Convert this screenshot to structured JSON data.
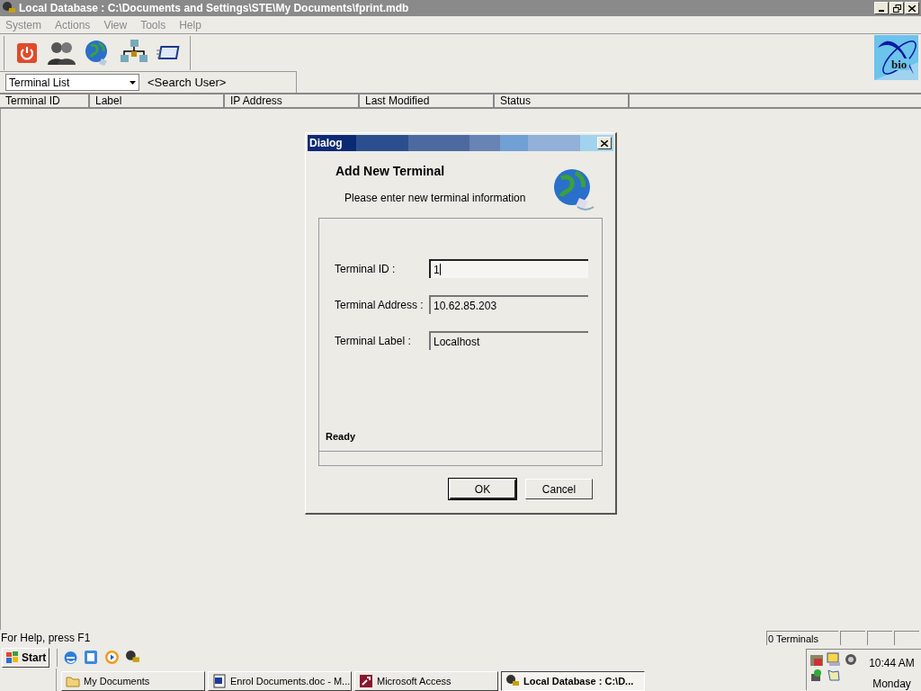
{
  "window": {
    "title": "Local Database : C:\\Documents and Settings\\STE\\My Documents\\fprint.mdb"
  },
  "logo_text": "bio",
  "menu": [
    "System",
    "Actions",
    "View",
    "Tools",
    "Help"
  ],
  "view_selector": {
    "value": "Terminal List"
  },
  "search_label": "<Search User>",
  "table": {
    "columns": [
      "Terminal ID",
      "Label",
      "IP Address",
      "Last Modified",
      "Status"
    ]
  },
  "dialog": {
    "title": "Dialog",
    "heading": "Add New Terminal",
    "subtitle": "Please enter new terminal information",
    "fields": [
      {
        "label": "Terminal ID :",
        "value": "1",
        "focused": true
      },
      {
        "label": "Terminal Address :",
        "value": "10.62.85.203",
        "focused": false
      },
      {
        "label": "Terminal Label :",
        "value": "Localhost",
        "focused": false
      }
    ],
    "status": "Ready",
    "buttons": [
      {
        "label": "OK",
        "default": true
      },
      {
        "label": "Cancel",
        "default": false
      }
    ]
  },
  "status_bar": {
    "help": "For Help, press F1",
    "panels": [
      "0 Terminals"
    ]
  },
  "taskbar": {
    "start": "Start",
    "tasks": [
      {
        "label": "My Documents",
        "kind": "folder",
        "selected": false
      },
      {
        "label": "Enrol Documents.doc - M...",
        "kind": "word",
        "selected": false
      },
      {
        "label": "Microsoft Access",
        "kind": "access",
        "selected": false
      },
      {
        "label": "Local Database : C:\\D...",
        "kind": "app",
        "selected": true
      }
    ],
    "clock": {
      "time": "10:44 AM",
      "day": "Monday"
    }
  }
}
